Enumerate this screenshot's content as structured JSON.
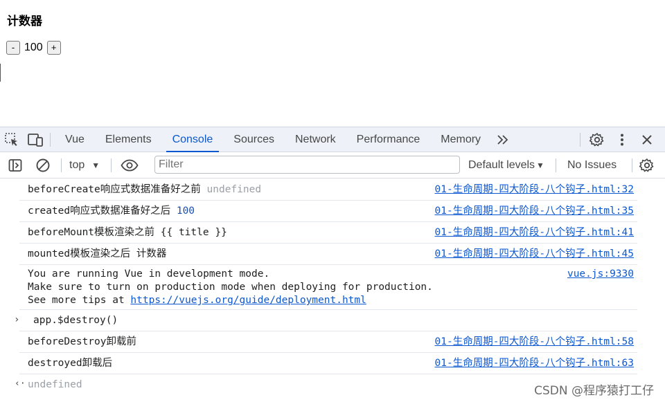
{
  "app": {
    "title": "计数器",
    "decrement_label": "-",
    "count": "100",
    "increment_label": "+"
  },
  "devtools": {
    "tabs": [
      {
        "label": "Vue"
      },
      {
        "label": "Elements"
      },
      {
        "label": "Console",
        "active": true
      },
      {
        "label": "Sources"
      },
      {
        "label": "Network"
      },
      {
        "label": "Performance"
      },
      {
        "label": "Memory"
      }
    ],
    "more_tabs": "»",
    "toolbar": {
      "context": "top",
      "filter_placeholder": "Filter",
      "levels": "Default levels",
      "issues": "No Issues"
    },
    "console": {
      "rows": [
        {
          "text": "beforeCreate响应式数据准备好之前",
          "value": "undefined",
          "value_kind": "undefined",
          "source": "01-生命周期-四大阶段-八个钩子.html:32"
        },
        {
          "text": "created响应式数据准备好之后",
          "value": "100",
          "value_kind": "number",
          "source": "01-生命周期-四大阶段-八个钩子.html:35"
        },
        {
          "text": "beforeMount模板渲染之前",
          "value": "{{ title }}",
          "value_kind": "plain",
          "source": "01-生命周期-四大阶段-八个钩子.html:41"
        },
        {
          "text": "mounted模板渲染之后",
          "value": "计数器",
          "value_kind": "plain",
          "source": "01-生命周期-四大阶段-八个钩子.html:45"
        }
      ],
      "vue_notice": {
        "line1": "You are running Vue in development mode.",
        "line2": "Make sure to turn on production mode when deploying for production.",
        "line3_prefix": "See more tips at ",
        "line3_link": "https://vuejs.org/guide/deployment.html",
        "source": "vue.js:9330"
      },
      "command": "app.$destroy()",
      "after_rows": [
        {
          "text": "beforeDestroy卸载前",
          "source": "01-生命周期-四大阶段-八个钩子.html:58"
        },
        {
          "text": "destroyed卸载后",
          "source": "01-生命周期-四大阶段-八个钩子.html:63"
        }
      ],
      "return_value": "undefined"
    }
  },
  "watermark": "CSDN @程序猿打工仔",
  "colors": {
    "accent": "#0b57d0",
    "tabbar_bg": "#eef2f8",
    "muted": "#9aa0a6"
  }
}
